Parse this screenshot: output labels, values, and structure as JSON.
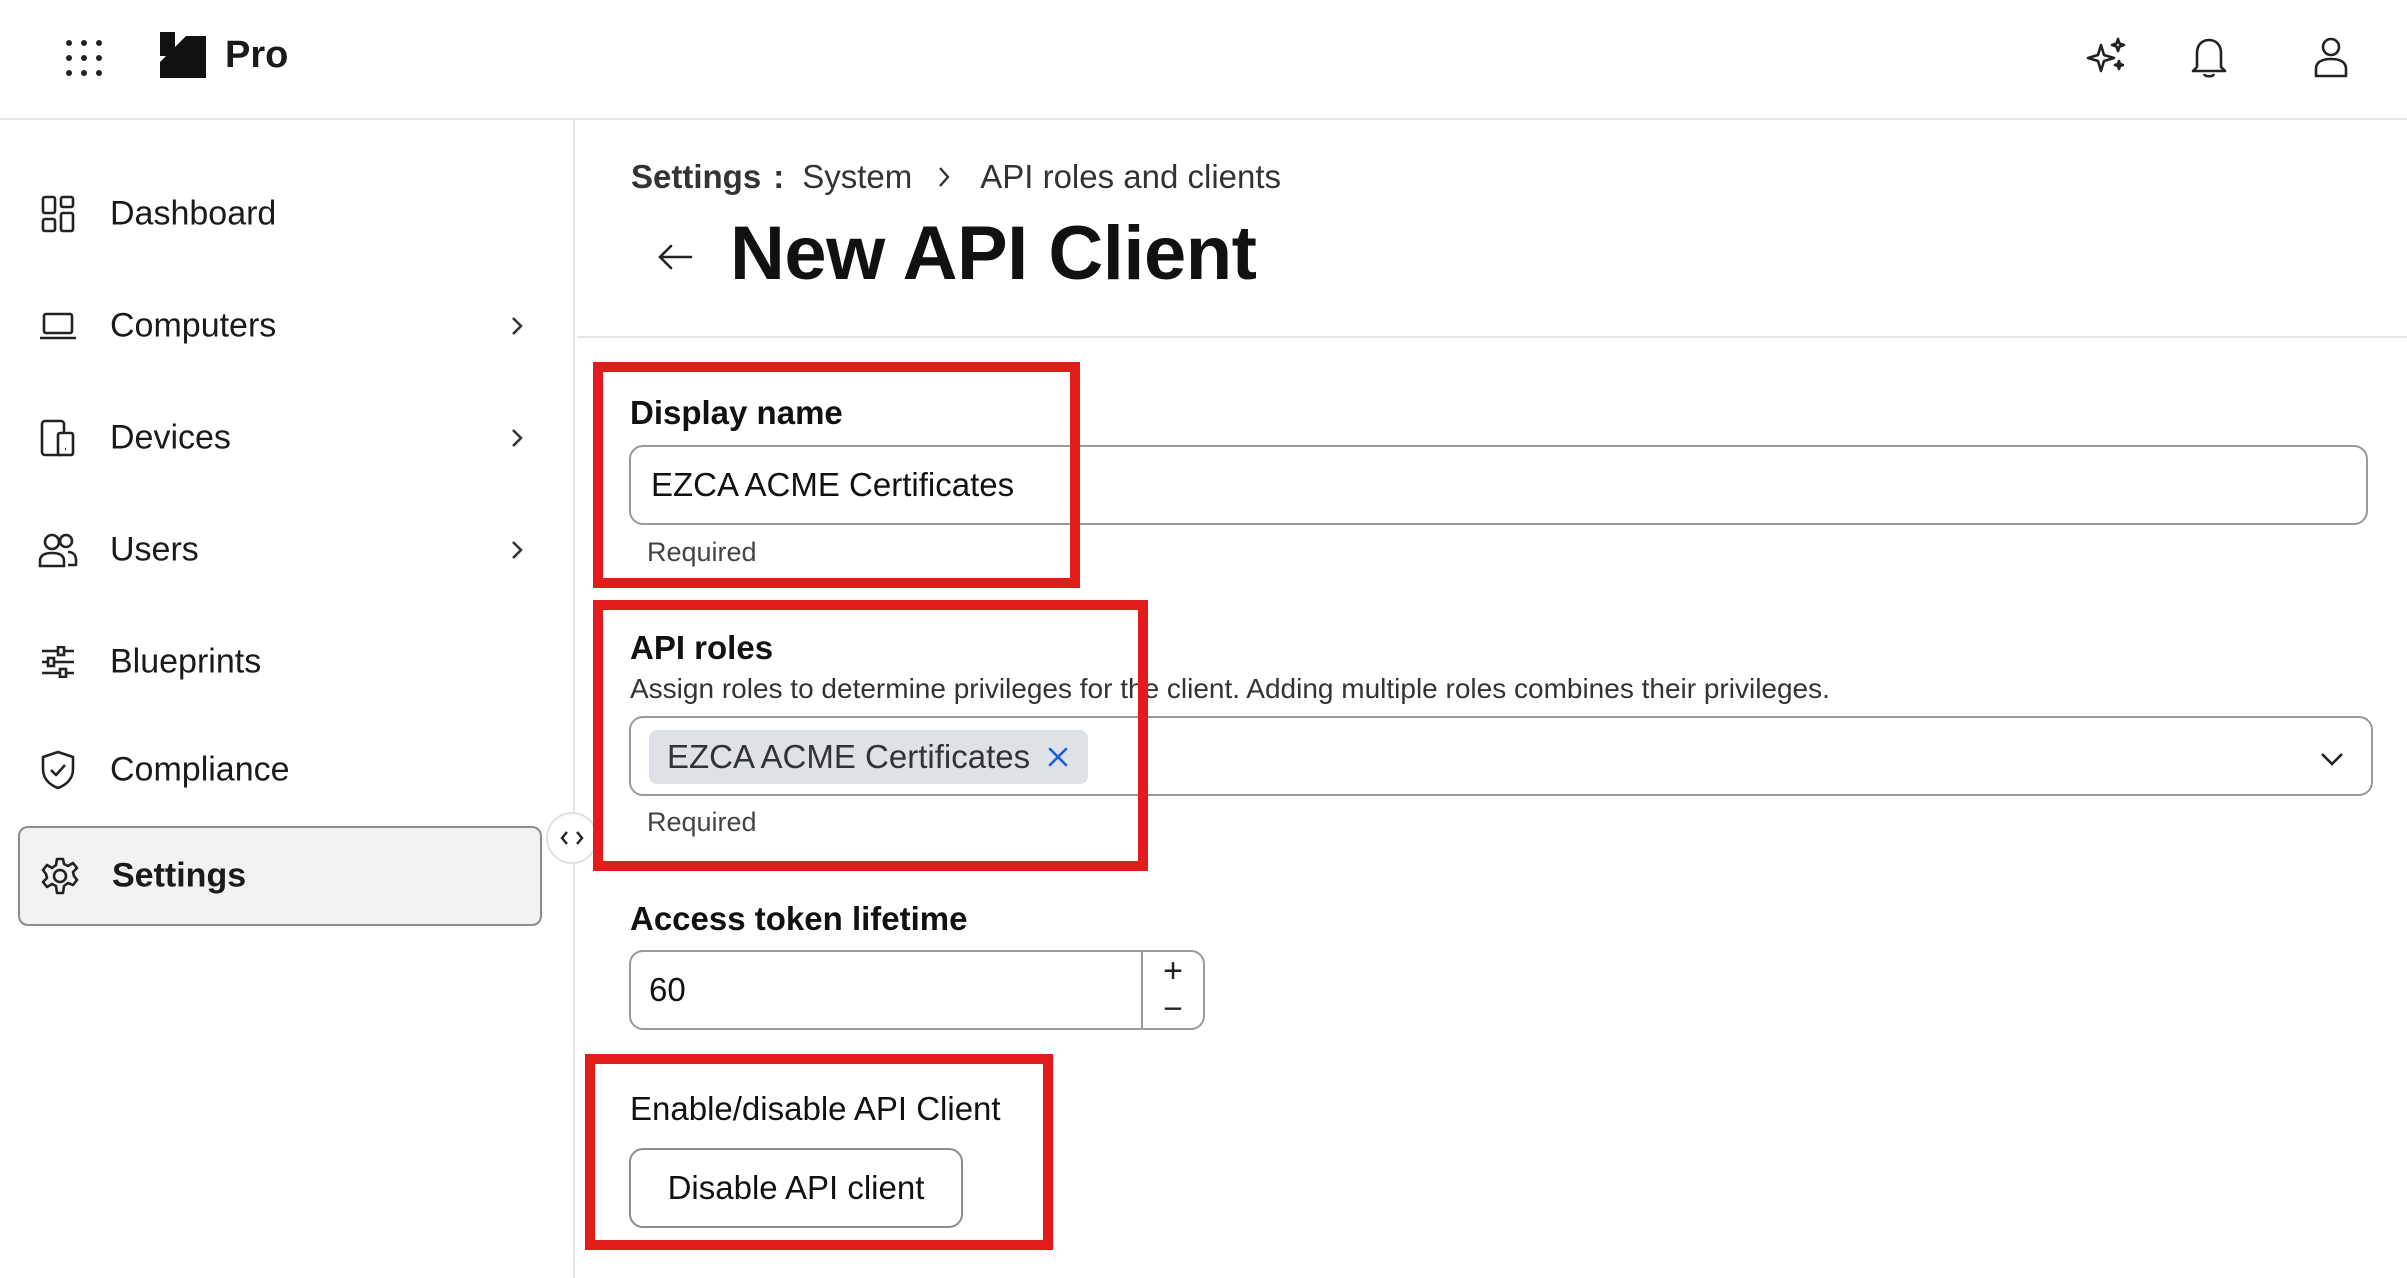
{
  "app": {
    "brand": "Pro"
  },
  "sidebar": {
    "items": [
      {
        "label": "Dashboard",
        "icon": "dashboard-icon",
        "has_chevron": false
      },
      {
        "label": "Computers",
        "icon": "laptop-icon",
        "has_chevron": true
      },
      {
        "label": "Devices",
        "icon": "devices-icon",
        "has_chevron": true
      },
      {
        "label": "Users",
        "icon": "users-icon",
        "has_chevron": true
      },
      {
        "label": "Blueprints",
        "icon": "sliders-icon",
        "has_chevron": false
      },
      {
        "label": "Compliance",
        "icon": "shield-check-icon",
        "has_chevron": false
      },
      {
        "label": "Settings",
        "icon": "gear-icon",
        "has_chevron": false,
        "active": true
      }
    ]
  },
  "breadcrumb": {
    "root": "Settings",
    "separator": ":",
    "items": [
      "System",
      "API roles and clients"
    ]
  },
  "page": {
    "title": "New API Client"
  },
  "form": {
    "display_name": {
      "label": "Display name",
      "value": "EZCA ACME Certificates",
      "helper": "Required"
    },
    "api_roles": {
      "label": "API roles",
      "description": "Assign roles to determine privileges for the client. Adding multiple roles combines their privileges.",
      "selected": [
        "EZCA ACME Certificates"
      ],
      "helper": "Required"
    },
    "access_token_lifetime": {
      "label": "Access token lifetime",
      "value": "60",
      "increment": "+",
      "decrement": "−"
    },
    "enable_disable": {
      "label": "Enable/disable API Client",
      "button_label": "Disable API client"
    }
  },
  "colors": {
    "annotation_red": "#e21b1b",
    "chip_bg": "#dee1e5",
    "chip_x": "#1a5fd6",
    "active_nav_bg": "#f2f2f2"
  }
}
